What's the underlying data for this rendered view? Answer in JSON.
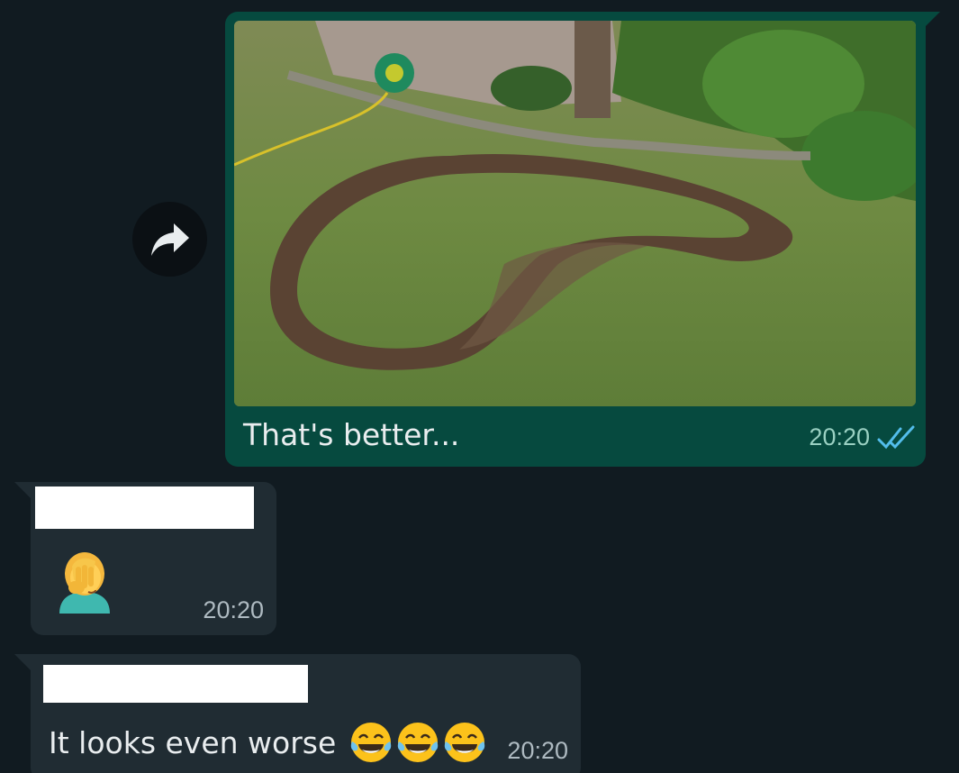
{
  "messages": {
    "outgoing": {
      "caption": "That's better...",
      "time": "20:20",
      "status_icon": "double-check-read-icon",
      "status_color": "#53bdeb"
    },
    "incoming_1": {
      "emoji": "face-palm-icon",
      "time": "20:20"
    },
    "incoming_2": {
      "text": "It looks even worse",
      "emoji": "tears-of-joy-icon",
      "time": "20:20"
    }
  },
  "actions": {
    "forward_icon": "forward-arrow-icon"
  },
  "colors": {
    "background": "#111b21",
    "outgoing_bubble": "#064a3f",
    "incoming_bubble": "#202c33"
  }
}
